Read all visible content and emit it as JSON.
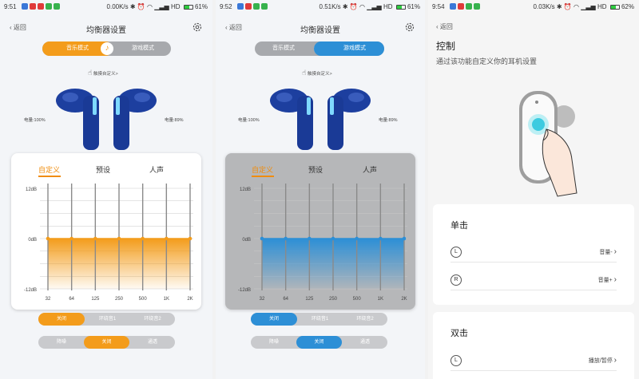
{
  "colors": {
    "orange": "#f39c1b",
    "blue": "#2d8fd6",
    "gray": "#a7a9ad"
  },
  "screens": [
    {
      "status": {
        "time": "9:51",
        "net": "0.00K/s",
        "signal": "HD",
        "battery": "61%"
      },
      "header": {
        "back": "返回",
        "title": "均衡器设置"
      },
      "mode": {
        "music": "音乐模式",
        "game": "游戏模式",
        "active": "music"
      },
      "touch_hint": "触摸自定义>",
      "battery_left": "电量:100%",
      "battery_right": "电量:89%",
      "eq_tabs": [
        "自定义",
        "预设",
        "人声"
      ],
      "eq_axis": {
        "top": "12dB",
        "mid": "0dB",
        "bottom": "-12dB"
      },
      "eq_bands": [
        "32",
        "64",
        "125",
        "250",
        "500",
        "1K",
        "2K"
      ],
      "eq_values_db": [
        0,
        0,
        0,
        0,
        0,
        0,
        0
      ],
      "ambient": [
        "关闭",
        "环绕音1",
        "环绕音2"
      ],
      "ambient_active": 0,
      "noise": [
        "降噪",
        "关闭",
        "通透"
      ],
      "noise_active": 1
    },
    {
      "status": {
        "time": "9:52",
        "net": "0.51K/s",
        "signal": "HD",
        "battery": "61%"
      },
      "header": {
        "back": "返回",
        "title": "均衡器设置"
      },
      "mode": {
        "music": "音乐模式",
        "game": "游戏模式",
        "active": "game"
      },
      "touch_hint": "触摸自定义>",
      "battery_left": "电量:100%",
      "battery_right": "电量:89%",
      "eq_tabs": [
        "自定义",
        "预设",
        "人声"
      ],
      "eq_axis": {
        "top": "12dB",
        "mid": "0dB",
        "bottom": "-12dB"
      },
      "eq_bands": [
        "32",
        "64",
        "125",
        "250",
        "500",
        "1K",
        "2K"
      ],
      "eq_values_db": [
        0,
        0,
        0,
        0,
        0,
        0,
        0
      ],
      "ambient": [
        "关闭",
        "环绕音1",
        "环绕音2"
      ],
      "ambient_active": 0,
      "noise": [
        "降噪",
        "关闭",
        "通透"
      ],
      "noise_active": 1
    },
    {
      "status": {
        "time": "9:54",
        "net": "0.03K/s",
        "signal": "HD",
        "battery": "62%"
      },
      "back": "返回",
      "title": "控制",
      "subtitle": "通过该功能自定义你的耳机设置",
      "single": {
        "title": "单击",
        "rows": [
          {
            "side": "L",
            "value": "音量-"
          },
          {
            "side": "R",
            "value": "音量+"
          }
        ]
      },
      "double": {
        "title": "双击",
        "rows": [
          {
            "side": "L",
            "value": "播放/暂停"
          }
        ]
      }
    }
  ]
}
